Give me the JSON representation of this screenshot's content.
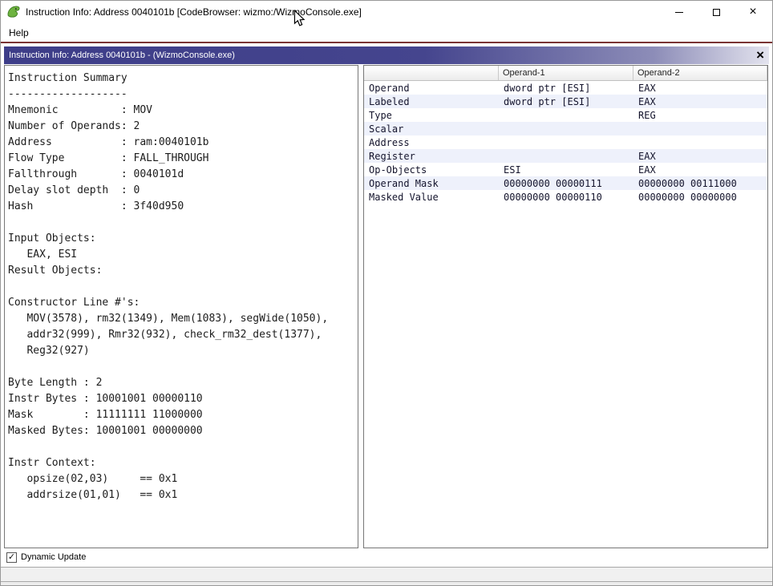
{
  "window": {
    "title": "Instruction Info: Address 0040101b [CodeBrowser: wizmo:/WizmoConsole.exe]",
    "menu": [
      "Help"
    ],
    "controls": {
      "close": "×"
    }
  },
  "dialog": {
    "title": "Instruction Info: Address 0040101b - (WizmoConsole.exe)",
    "close": "×"
  },
  "summary": {
    "lines": [
      "Instruction Summary",
      "-------------------",
      "Mnemonic          : MOV",
      "Number of Operands: 2",
      "Address           : ram:0040101b",
      "Flow Type         : FALL_THROUGH",
      "Fallthrough       : 0040101d",
      "Delay slot depth  : 0",
      "Hash              : 3f40d950",
      "",
      "Input Objects:",
      "   EAX, ESI",
      "Result Objects:",
      "",
      "Constructor Line #'s:",
      "   MOV(3578), rm32(1349), Mem(1083), segWide(1050),",
      "   addr32(999), Rmr32(932), check_rm32_dest(1377),",
      "   Reg32(927)",
      "",
      "Byte Length : 2",
      "Instr Bytes : 10001001 00000110",
      "Mask        : 11111111 11000000",
      "Masked Bytes: 10001001 00000000",
      "",
      "Instr Context:",
      "   opsize(02,03)     == 0x1",
      "   addrsize(01,01)   == 0x1"
    ]
  },
  "operand_table": {
    "columns": [
      "",
      "Operand-1",
      "Operand-2"
    ],
    "rows": [
      [
        "Operand",
        "dword ptr [ESI]",
        "EAX"
      ],
      [
        "Labeled",
        "dword ptr [ESI]",
        "EAX"
      ],
      [
        "Type",
        "",
        "REG"
      ],
      [
        "Scalar",
        "",
        ""
      ],
      [
        "Address",
        "",
        ""
      ],
      [
        "Register",
        "",
        "EAX"
      ],
      [
        "Op-Objects",
        "ESI",
        "EAX"
      ],
      [
        "Operand Mask",
        "00000000 00000111",
        "00000000 00111000"
      ],
      [
        "Masked Value",
        "00000000 00000110",
        "00000000 00000000"
      ]
    ]
  },
  "footer": {
    "dynamic_update_label": "Dynamic Update",
    "dynamic_update_checked": true,
    "check_glyph": "✓"
  },
  "colors": {
    "dialog_header_start": "#3d3d88",
    "dialog_header_end": "#e3e3ee",
    "menu_separator": "#7a3434",
    "row_alt": "#eef1fb",
    "app_icon_green": "#6db33f"
  }
}
